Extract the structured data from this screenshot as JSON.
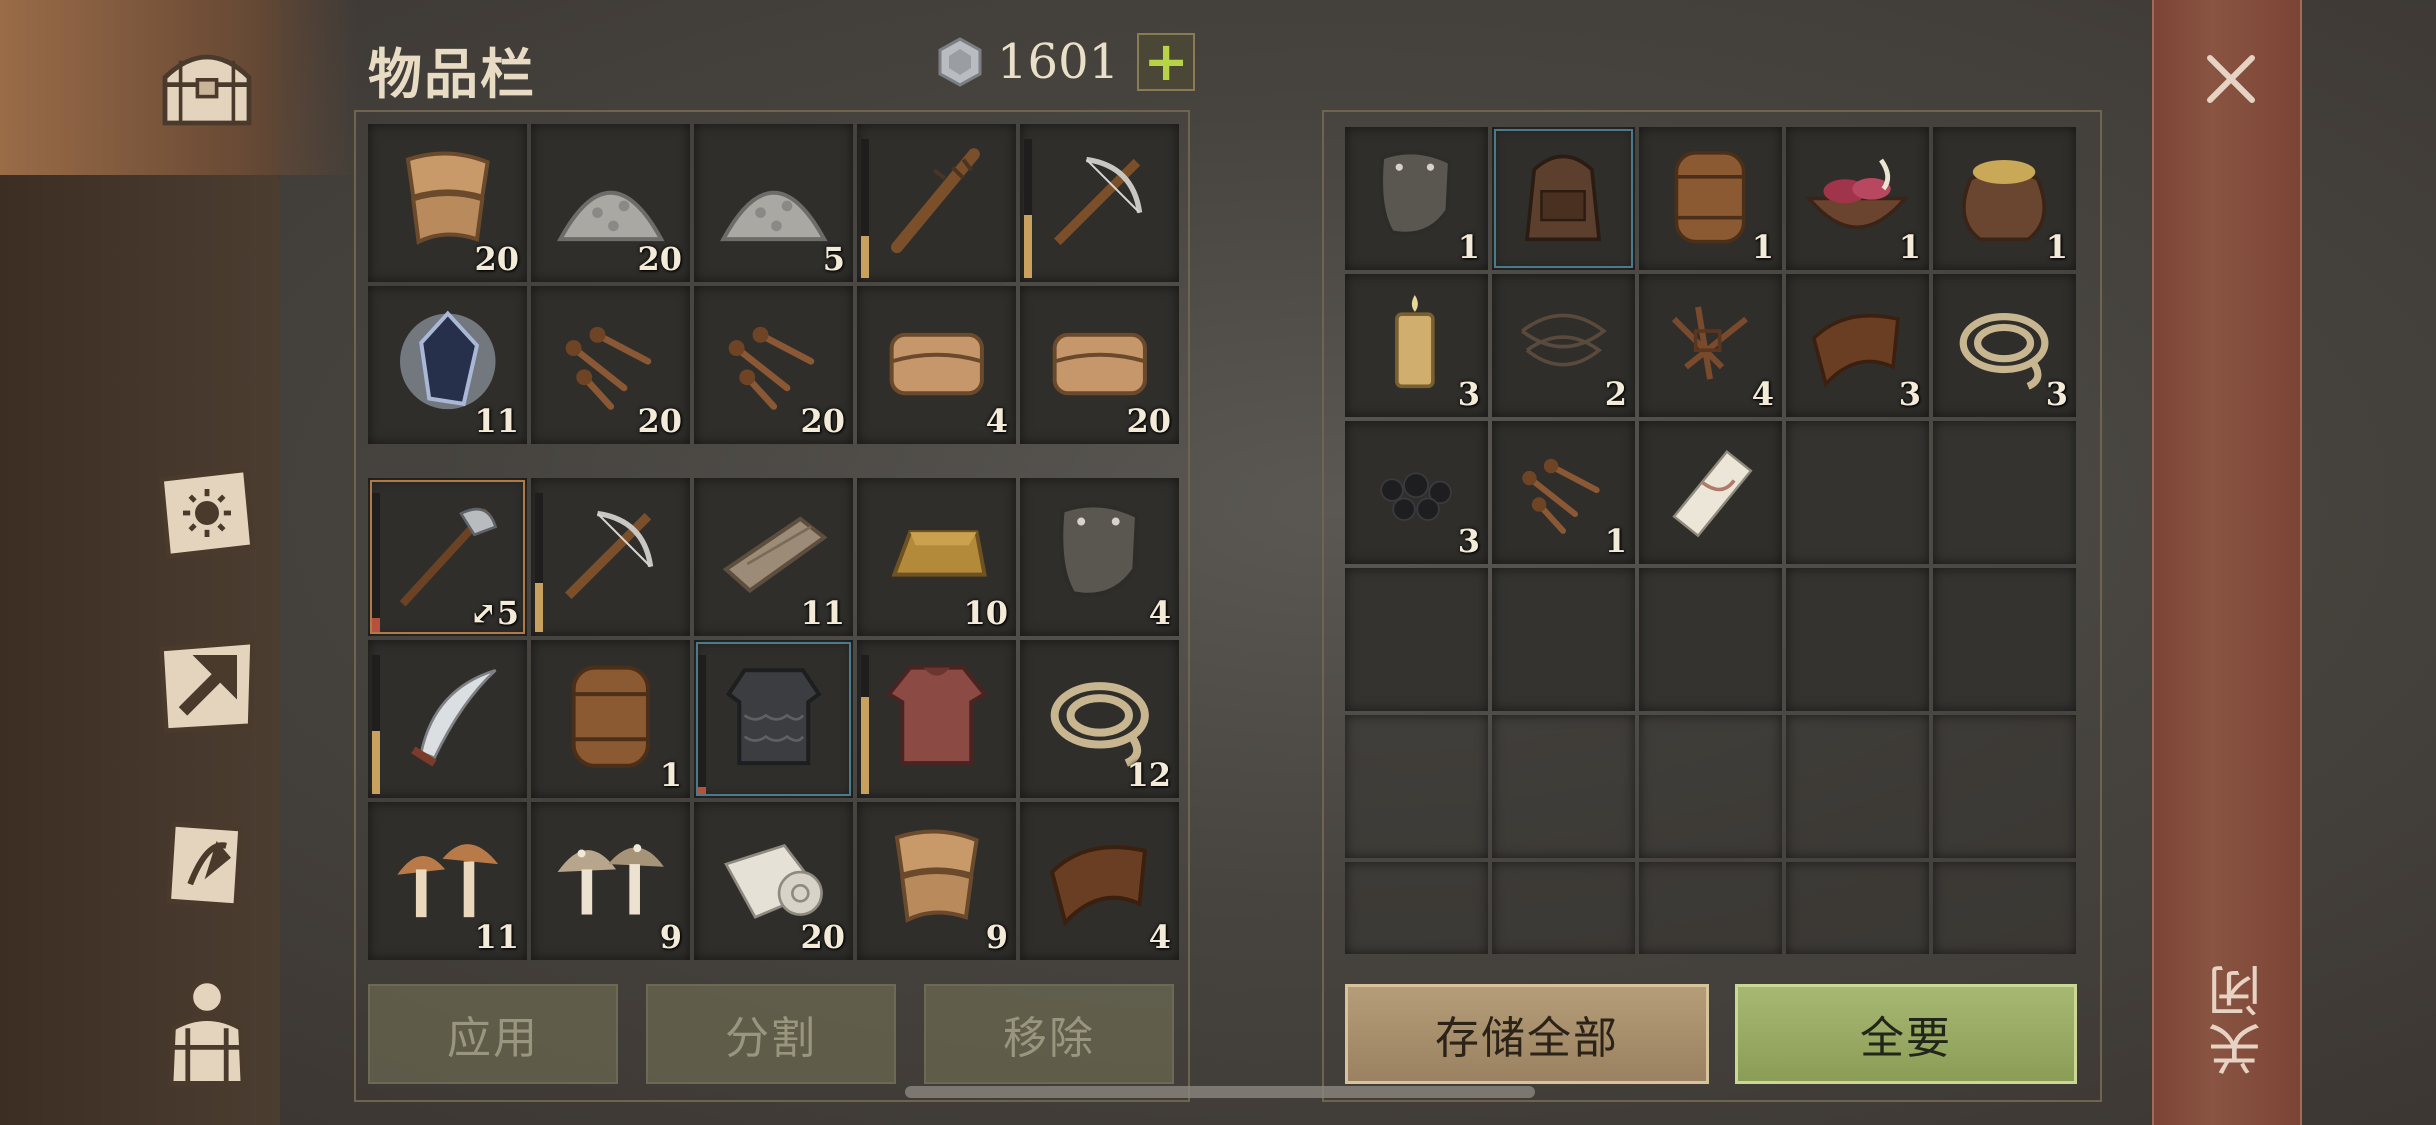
{
  "header": {
    "title": "物品栏",
    "coins": "1601",
    "add_label": "+"
  },
  "colors": {
    "accent_green": "#b8d347",
    "durability_orange": "#c9a15e",
    "durability_red": "#b5513c"
  },
  "nav": [
    {
      "name": "storage-chest-icon"
    },
    {
      "name": "skills-book-icon"
    },
    {
      "name": "crafting-map-icon"
    },
    {
      "name": "quest-scroll-icon"
    },
    {
      "name": "character-backpack-icon"
    }
  ],
  "inventory_top": [
    {
      "icon": "cloth-icon",
      "qty": "20"
    },
    {
      "icon": "stone-pile-icon",
      "qty": "20"
    },
    {
      "icon": "stone-pile-icon",
      "qty": "5"
    },
    {
      "icon": "spiked-club-icon",
      "qty": "",
      "dur": 0.3
    },
    {
      "icon": "crossbow-icon",
      "qty": "",
      "dur": 0.45
    },
    {
      "icon": "crystal-icon",
      "qty": "11"
    },
    {
      "icon": "nails-icon",
      "qty": "20"
    },
    {
      "icon": "nails-icon",
      "qty": "20"
    },
    {
      "icon": "fabric-icon",
      "qty": "4"
    },
    {
      "icon": "fabric-icon",
      "qty": "20"
    }
  ],
  "inventory_bottom": [
    {
      "icon": "halberd-icon",
      "qty": "5",
      "qty_prefix": "⤢",
      "dur": 0.1,
      "dur_color": "red",
      "selected": "orange"
    },
    {
      "icon": "crossbow-icon",
      "qty": "",
      "dur": 0.35
    },
    {
      "icon": "wood-plank-icon",
      "qty": "11"
    },
    {
      "icon": "gold-ingot-icon",
      "qty": "10"
    },
    {
      "icon": "pauldron-icon",
      "qty": "4"
    },
    {
      "icon": "scimitar-icon",
      "qty": "",
      "dur": 0.45
    },
    {
      "icon": "barrel-icon",
      "qty": "1"
    },
    {
      "icon": "scale-armor-icon",
      "qty": "",
      "dur": 0.05,
      "dur_color": "red",
      "selected": "blue"
    },
    {
      "icon": "chainmail-icon",
      "qty": "",
      "dur": 0.7
    },
    {
      "icon": "rope-icon",
      "qty": "12"
    },
    {
      "icon": "mushroom-icon",
      "qty": "11"
    },
    {
      "icon": "spotted-mushroom-icon",
      "qty": "9"
    },
    {
      "icon": "cloth-roll-icon",
      "qty": "20"
    },
    {
      "icon": "cloth-icon",
      "qty": "9"
    },
    {
      "icon": "leather-icon",
      "qty": "4"
    }
  ],
  "storage": [
    {
      "icon": "pauldron-icon",
      "qty": "1"
    },
    {
      "icon": "backpack-icon",
      "qty": "",
      "selected": "blue"
    },
    {
      "icon": "barrel-icon",
      "qty": "1"
    },
    {
      "icon": "meat-bowl-icon",
      "qty": "1"
    },
    {
      "icon": "grain-sack-icon",
      "qty": "1"
    },
    {
      "icon": "candle-icon",
      "qty": "3"
    },
    {
      "icon": "wire-icon",
      "qty": "2"
    },
    {
      "icon": "scrap-icon",
      "qty": "4"
    },
    {
      "icon": "leather-icon",
      "qty": "3"
    },
    {
      "icon": "rope-icon",
      "qty": "3"
    },
    {
      "icon": "coal-icon",
      "qty": "3"
    },
    {
      "icon": "nails-icon",
      "qty": "1"
    },
    {
      "icon": "paper-scroll-icon",
      "qty": ""
    }
  ],
  "buttons": {
    "apply": "应用",
    "split": "分割",
    "remove": "移除",
    "store_all": "存储全部",
    "take_all": "全要"
  },
  "close_label": "关闭"
}
